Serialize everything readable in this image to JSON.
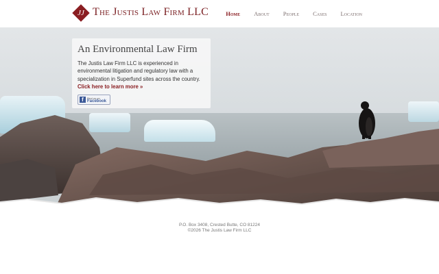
{
  "header": {
    "logo_monogram": "JJ",
    "firm_name": "The Justis Law Firm LLC",
    "nav": [
      {
        "label": "Home",
        "active": true
      },
      {
        "label": "About",
        "active": false
      },
      {
        "label": "People",
        "active": false
      },
      {
        "label": "Cases",
        "active": false
      },
      {
        "label": "Location",
        "active": false
      }
    ]
  },
  "card": {
    "title": "An Environmental Law Firm",
    "body": "The Justis Law Firm LLC is experienced in environmental litigation and regulatory law with a specialization in Superfund sites across the country.",
    "link": "Click here to learn more »",
    "facebook_small": "Find us on",
    "facebook_big": "Facebook"
  },
  "footer": {
    "address": "P.O. Box 3408, Crested Butte, CO 81224",
    "copyright": "©2026 The Justis Law Firm LLC"
  },
  "colors": {
    "brand": "#8a1e22",
    "facebook": "#3b5998"
  }
}
